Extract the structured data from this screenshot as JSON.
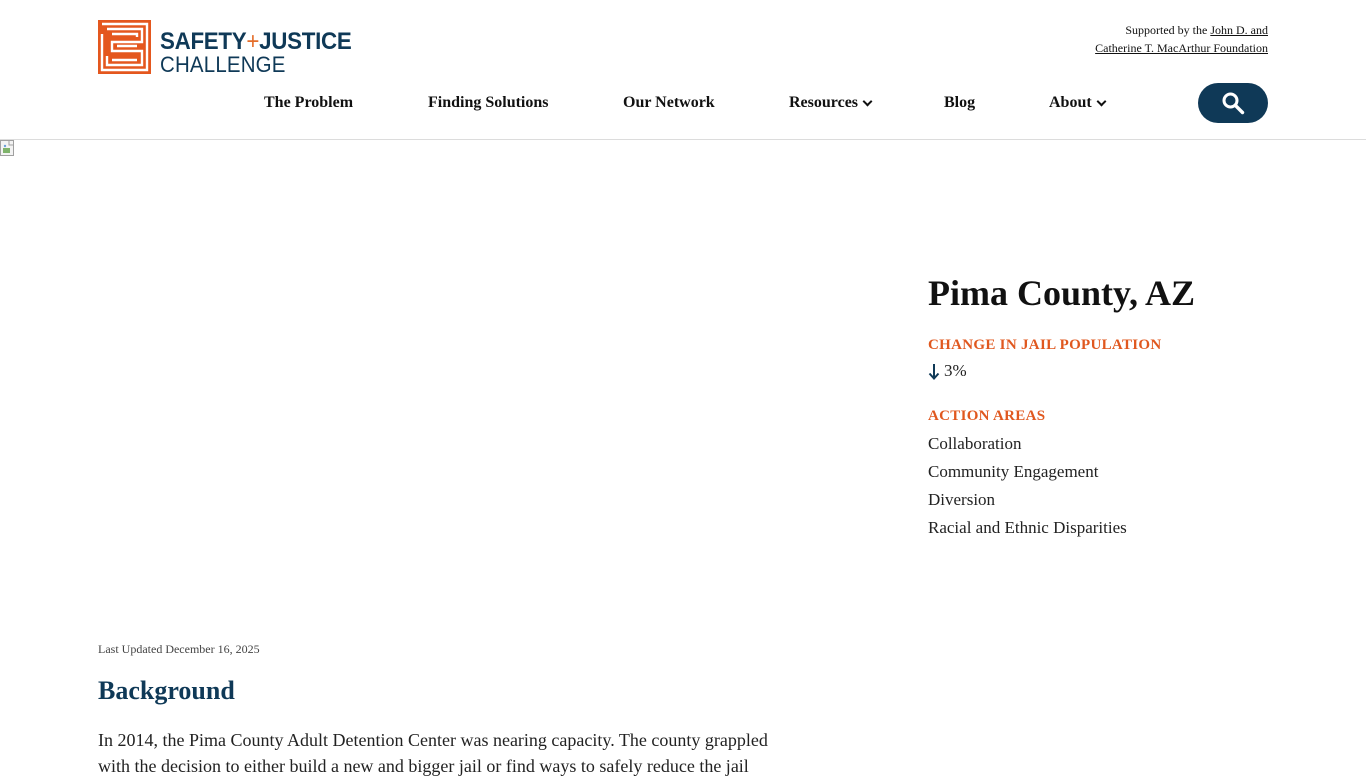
{
  "header": {
    "logo": {
      "line1_part1": "SAFETY",
      "line1_plus": "+",
      "line1_part2": "JUSTICE",
      "line2": "CHALLENGE"
    },
    "support": {
      "prefix": "Supported by the ",
      "link_part1": "John D. and",
      "link_part2": "Catherine T. MacArthur Foundation"
    },
    "nav": [
      {
        "label": "The Problem",
        "has_dropdown": false
      },
      {
        "label": "Finding Solutions",
        "has_dropdown": false
      },
      {
        "label": "Our Network",
        "has_dropdown": false
      },
      {
        "label": "Resources",
        "has_dropdown": true
      },
      {
        "label": "Blog",
        "has_dropdown": false
      },
      {
        "label": "About",
        "has_dropdown": true
      }
    ],
    "search_icon": "search-icon"
  },
  "colors": {
    "brand_navy": "#0f3957",
    "brand_orange": "#e0581f",
    "logo_orange": "#e4571e"
  },
  "county": {
    "title": "Pima County, AZ",
    "change_label": "CHANGE IN JAIL POPULATION",
    "change_direction": "down",
    "change_value": "3%",
    "areas_label": "ACTION AREAS",
    "action_areas": [
      "Collaboration",
      "Community Engagement",
      "Diversion",
      "Racial and Ethnic Disparities"
    ]
  },
  "article": {
    "last_updated": "Last Updated December 16, 2025",
    "section_title": "Background",
    "body": "In 2014, the Pima County Adult Detention Center was nearing capacity. The county grappled with the decision to either build a new and bigger jail or find ways to safely reduce the jail"
  }
}
